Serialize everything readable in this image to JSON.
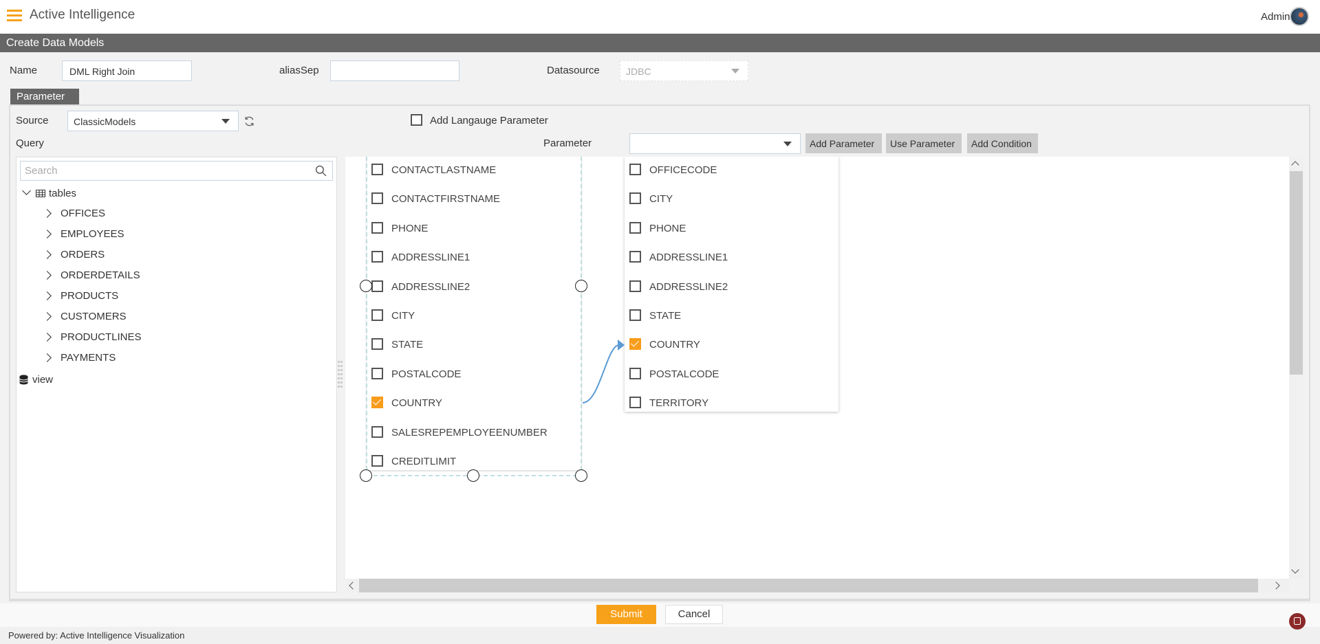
{
  "header": {
    "app_title": "Active Intelligence",
    "user": "Admin",
    "menu_icon": "hamburger-icon",
    "accent": "#f7a11a"
  },
  "titlebar": {
    "title": "Create Data Models"
  },
  "form": {
    "name_label": "Name",
    "name_value": "DML Right Join",
    "alias_label": "aliasSep",
    "alias_value": "",
    "datasource_label": "Datasource",
    "datasource_value": "JDBC"
  },
  "tab": {
    "label": "Parameter"
  },
  "source": {
    "label": "Source",
    "value": "ClassicModels",
    "add_lang_label": "Add Langauge Parameter",
    "add_lang_checked": false
  },
  "query": {
    "label": "Query",
    "parameter_label": "Parameter",
    "parameter_value": "",
    "buttons": [
      "Add Parameter",
      "Use Parameter",
      "Add Condition"
    ]
  },
  "tree": {
    "search_placeholder": "Search",
    "root": "tables",
    "children": [
      "OFFICES",
      "EMPLOYEES",
      "ORDERS",
      "ORDERDETAILS",
      "PRODUCTS",
      "CUSTOMERS",
      "PRODUCTLINES",
      "PAYMENTS"
    ],
    "view": "view"
  },
  "canvas": {
    "left_table": {
      "columns": [
        {
          "name": "CONTACTLASTNAME",
          "checked": false
        },
        {
          "name": "CONTACTFIRSTNAME",
          "checked": false
        },
        {
          "name": "PHONE",
          "checked": false
        },
        {
          "name": "ADDRESSLINE1",
          "checked": false
        },
        {
          "name": "ADDRESSLINE2",
          "checked": false
        },
        {
          "name": "CITY",
          "checked": false
        },
        {
          "name": "STATE",
          "checked": false
        },
        {
          "name": "POSTALCODE",
          "checked": false
        },
        {
          "name": "COUNTRY",
          "checked": true
        },
        {
          "name": "SALESREPEMPLOYEENUMBER",
          "checked": false
        },
        {
          "name": "CREDITLIMIT",
          "checked": false
        }
      ]
    },
    "right_table": {
      "columns": [
        {
          "name": "OFFICECODE",
          "checked": false
        },
        {
          "name": "CITY",
          "checked": false
        },
        {
          "name": "PHONE",
          "checked": false
        },
        {
          "name": "ADDRESSLINE1",
          "checked": false
        },
        {
          "name": "ADDRESSLINE2",
          "checked": false
        },
        {
          "name": "STATE",
          "checked": false
        },
        {
          "name": "COUNTRY",
          "checked": true
        },
        {
          "name": "POSTALCODE",
          "checked": false
        },
        {
          "name": "TERRITORY",
          "checked": false
        }
      ]
    },
    "join_color": "#5b9bd5"
  },
  "actions": {
    "submit": "Submit",
    "cancel": "Cancel"
  },
  "footer": {
    "text": "Powered by: Active Intelligence Visualization"
  }
}
